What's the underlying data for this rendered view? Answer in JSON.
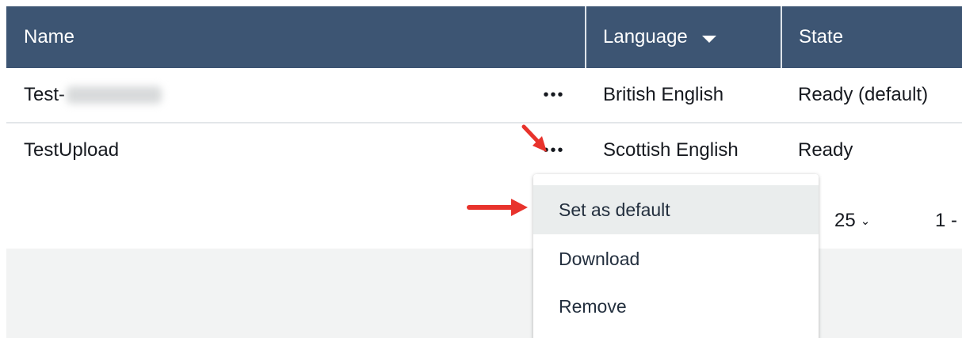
{
  "table": {
    "columns": {
      "name": "Name",
      "language": "Language",
      "state": "State"
    },
    "rows": [
      {
        "name": "Test-",
        "language": "British English",
        "state": "Ready (default)",
        "actions": "•••"
      },
      {
        "name": "TestUpload",
        "language": "Scottish English",
        "state": "Ready",
        "actions": "•••"
      }
    ]
  },
  "pagination": {
    "per_page": "25",
    "range": "1 -"
  },
  "context_menu": {
    "items": [
      "Set as default",
      "Download",
      "Remove"
    ],
    "highlighted": "Set as default"
  },
  "colors": {
    "header_bg": "#3d5573",
    "annotation_arrow": "#e8332c",
    "menu_highlight": "#eaeded"
  },
  "icons": {
    "sort": "caret-down-icon",
    "actions": "ellipsis-icon",
    "dropdown": "chevron-down-icon",
    "annotation": "red-arrow-icon"
  }
}
